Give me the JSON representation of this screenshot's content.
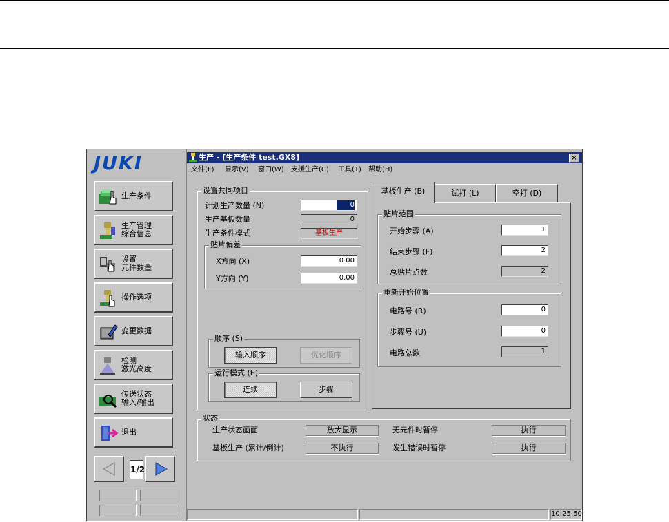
{
  "brand": {
    "logo": "JUKI"
  },
  "nav": [
    {
      "label": "生产条件",
      "icon": "production-condition-icon"
    },
    {
      "label": "生产管理\n综合信息",
      "icon": "production-management-icon"
    },
    {
      "label": "设置\n元件数量",
      "icon": "component-count-icon"
    },
    {
      "label": "操作选项",
      "icon": "operation-options-icon"
    },
    {
      "label": "变更数据",
      "icon": "change-data-icon"
    },
    {
      "label": "检测\n激光高度",
      "icon": "laser-height-icon"
    },
    {
      "label": "传送状态\n输入/输出",
      "icon": "transfer-status-icon"
    },
    {
      "label": "退出",
      "icon": "exit-icon"
    }
  ],
  "pager": {
    "page": "1/2"
  },
  "window": {
    "title": "生产 - [生产条件 test.GX8]",
    "close": "×"
  },
  "menu": [
    "文件(F)",
    "显示(V)",
    "窗口(W)",
    "支援生产(C)",
    "工具(T)",
    "帮助(H)"
  ],
  "common": {
    "title": "设置共同项目",
    "plan_qty_label": "计划生产数量 (N)",
    "plan_qty_value": "0",
    "board_qty_label": "生产基板数量",
    "board_qty_value": "0",
    "mode_label": "生产条件模式",
    "mode_value": "基板生产"
  },
  "offset": {
    "title": "贴片偏差",
    "x_label": "X方向 (X)",
    "x_value": "0.00",
    "y_label": "Y方向 (Y)",
    "y_value": "0.00"
  },
  "order": {
    "title": "顺序 (S)",
    "input_order": "输入顺序",
    "optimize_order": "优化顺序"
  },
  "runmode": {
    "title": "运行模式 (E)",
    "continuous": "连续",
    "step": "步骤"
  },
  "tabs": [
    "基板生产 (B)",
    "试打 (L)",
    "空打 (D)"
  ],
  "range": {
    "title": "贴片范围",
    "start_label": "开始步骤 (A)",
    "start_value": "1",
    "end_label": "结束步骤 (F)",
    "end_value": "2",
    "total_label": "总贴片点数",
    "total_value": "2"
  },
  "restart": {
    "title": "重新开始位置",
    "circuit_label": "电路号 (R)",
    "circuit_value": "0",
    "step_label": "步骤号 (U)",
    "step_value": "0",
    "total_label": "电路总数",
    "total_value": "1"
  },
  "status": {
    "title": "状态",
    "screen_label": "生产状态画面",
    "screen_value": "放大显示",
    "no_part_label": "无元件时暂停",
    "no_part_value": "执行",
    "board_label": "基板生产 (累计/倒计)",
    "board_value": "不执行",
    "error_label": "发生错误时暂停",
    "error_value": "执行"
  },
  "clock": "10:25:50",
  "colors": {
    "titlebar": "#1a2f7a",
    "logo": "#0a48b0",
    "mode_text": "#e00000"
  }
}
